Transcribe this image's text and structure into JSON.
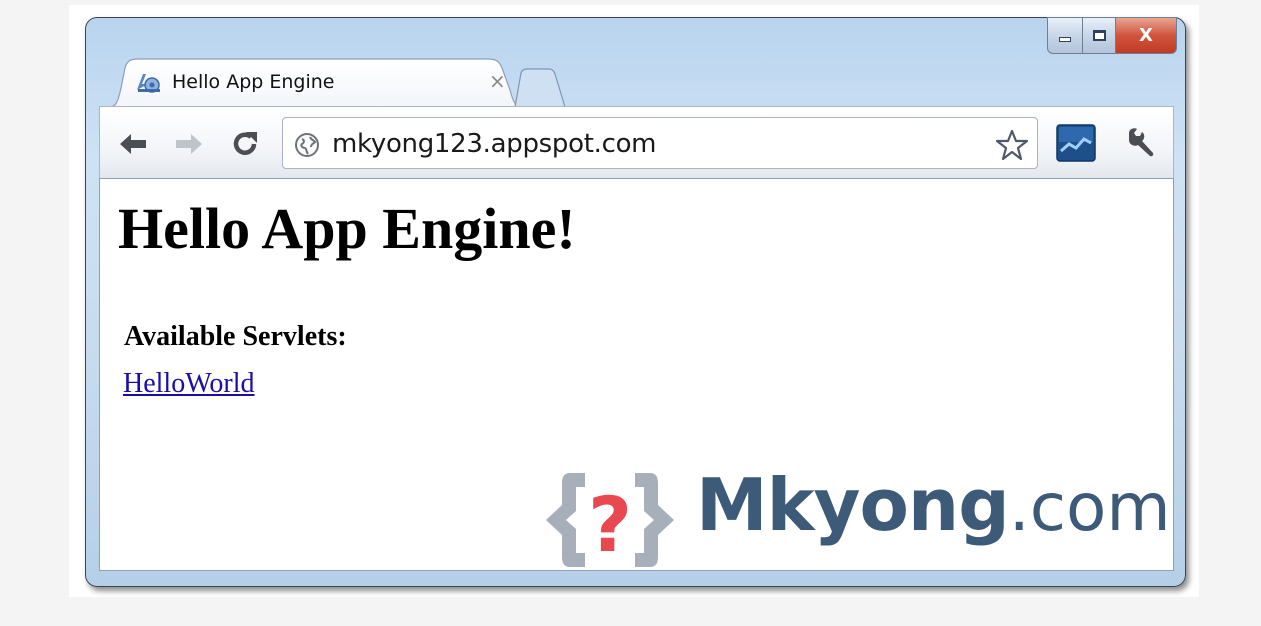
{
  "tab": {
    "title": "Hello App Engine",
    "close_glyph": "×",
    "favicon": "app-engine-icon"
  },
  "window_controls": {
    "minimize": "minimize-icon",
    "maximize": "maximize-icon",
    "close_glyph": "X"
  },
  "toolbar": {
    "back": "back-arrow-icon",
    "forward": "forward-arrow-icon",
    "reload": "reload-icon",
    "site_icon": "globe-icon",
    "bookmark": "star-icon",
    "extension": "chart-extension-icon",
    "menu": "wrench-icon"
  },
  "omnibox": {
    "url": "mkyong123.appspot.com"
  },
  "page": {
    "heading": "Hello App Engine!",
    "section_title": "Available Servlets:",
    "links": [
      {
        "label": "HelloWorld"
      }
    ]
  },
  "watermark": {
    "brand": "Mkyong",
    "tld": ".com",
    "logo_glyph": "?"
  },
  "colors": {
    "link": "#1a0dab",
    "watermark_text": "#3d5a78",
    "watermark_logo": "#e8484f",
    "close_button": "#c8432b"
  }
}
